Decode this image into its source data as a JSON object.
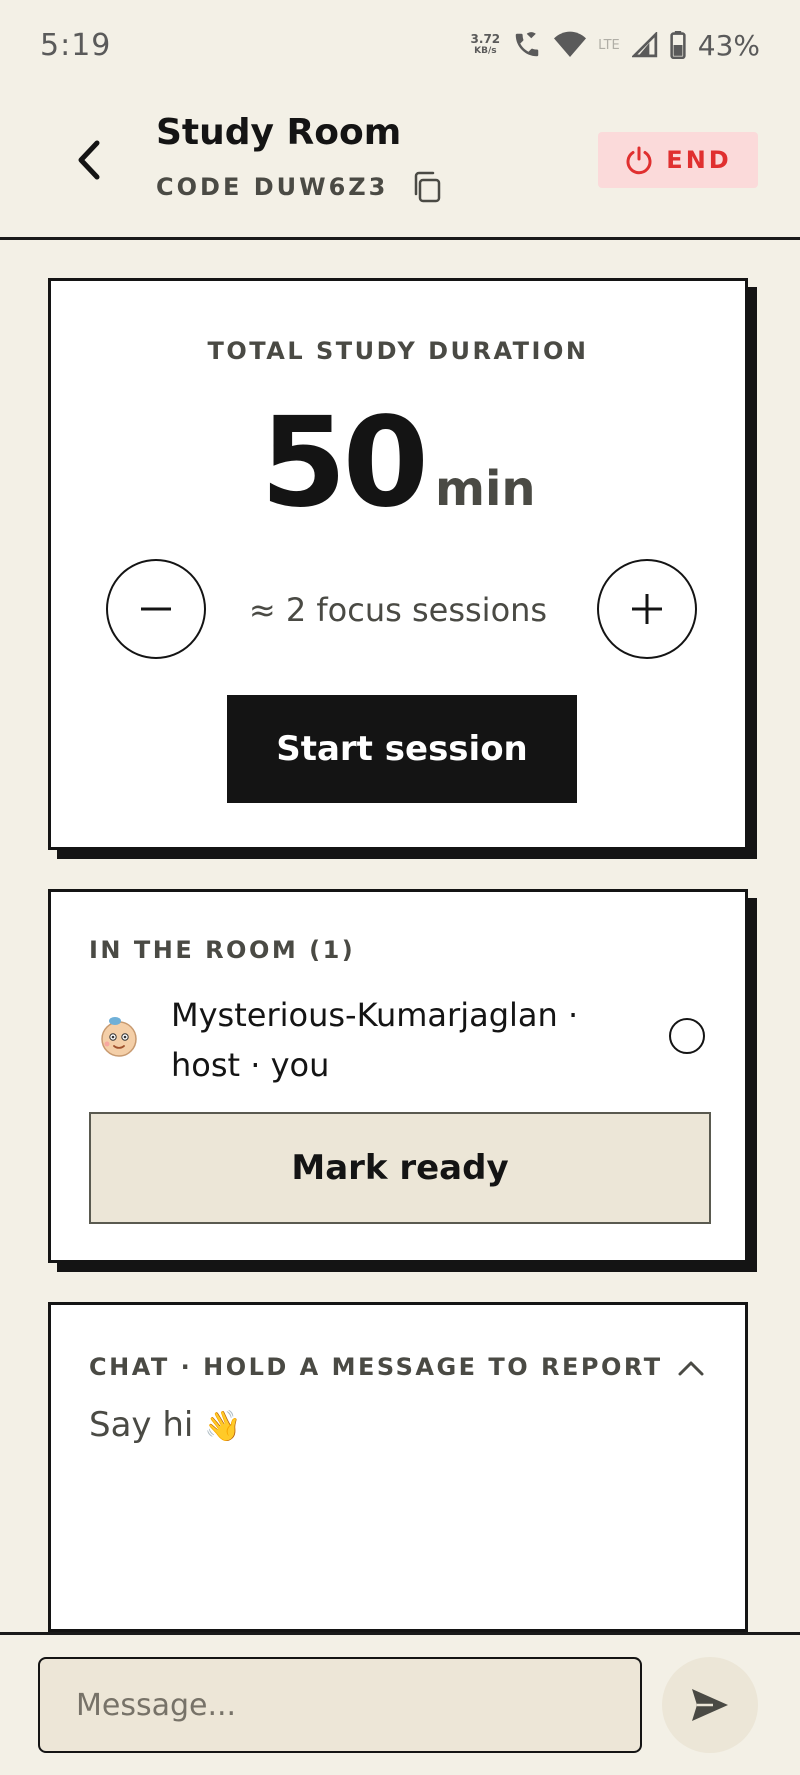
{
  "status_bar": {
    "time": "5:19",
    "net_speed_value": "3.72",
    "net_speed_unit": "KB/s",
    "network": "LTE",
    "battery": "43%"
  },
  "header": {
    "title": "Study Room",
    "code": "CODE DUW6Z3",
    "end_label": "END"
  },
  "timer": {
    "label": "TOTAL STUDY DURATION",
    "value": "50",
    "unit": "min",
    "sessions": "≈ 2 focus sessions",
    "start_label": "Start session"
  },
  "room": {
    "label": "IN THE ROOM (1)",
    "member": {
      "name_line1": "Mysterious-Kumarjaglan  ·",
      "name_line2": "host  · you",
      "ready": false
    },
    "mark_ready_label": "Mark ready"
  },
  "chat": {
    "label": "CHAT · HOLD A MESSAGE TO REPORT",
    "empty_text": "Say hi",
    "empty_emoji": "👋",
    "expanded": true
  },
  "composer": {
    "placeholder": "Message..."
  },
  "colors": {
    "background": "#f3f0e6",
    "ink": "#141414",
    "muted": "#4a4a44",
    "end_bg": "#fbdada",
    "end_fg": "#e03030",
    "soft_button": "#ece6d7"
  },
  "icons": {
    "back": "chevron-left-icon",
    "copy": "copy-icon",
    "end": "power-icon",
    "minus": "minus-icon",
    "plus": "plus-icon",
    "collapse": "chevron-up-icon",
    "send": "send-icon"
  }
}
